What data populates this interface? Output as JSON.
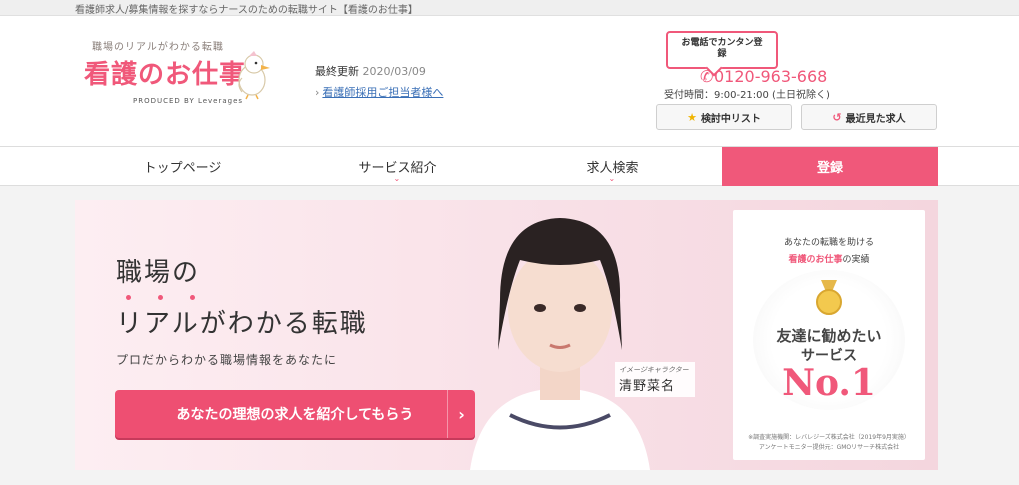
{
  "topbar": {
    "text": "看護師求人/募集情報を探すならナースのための転職サイト【看護のお仕事】"
  },
  "logo": {
    "tagline": "職場のリアルがわかる転職",
    "brand": "看護のお仕事",
    "produced_by": "PRODUCED BY Leverages"
  },
  "info": {
    "updated_label": "最終更新",
    "updated_date": "2020/03/09",
    "recruit_link": "看護師採用ご担当者様へ"
  },
  "contact": {
    "bubble_line1": "お電話でカンタン登",
    "bubble_line2": "録",
    "phone": "0120-963-668",
    "hours": "受付時間：9:00-21:00 (土日祝除く)"
  },
  "utility": {
    "watchlist": "検討中リスト",
    "recent": "最近見た求人"
  },
  "nav": {
    "top": "トップページ",
    "service": "サービス紹介",
    "search": "求人検索",
    "register": "登録"
  },
  "hero": {
    "line1": "職場の",
    "line2": "リアルがわかる転職",
    "sub": "プロだからわかる職場情報をあなたに",
    "cta": "あなたの理想の求人を紹介してもらう",
    "character_role": "イメージキャラクター",
    "character_name": "清野菜名"
  },
  "badge": {
    "line1": "あなたの転職を助ける",
    "line2_brand": "看護のお仕事",
    "line2_suffix": "の実績",
    "text1": "友達に勧めたい",
    "text2": "サービス",
    "no1": "No.1",
    "foot1": "※調査実施機関：レバレジーズ株式会社（2019年9月実施）",
    "foot2": "アンケートモニター提供元：GMOリサーチ株式会社"
  },
  "colors": {
    "accent": "#f0587a",
    "link": "#3a6fb6",
    "star": "#f0b400"
  }
}
